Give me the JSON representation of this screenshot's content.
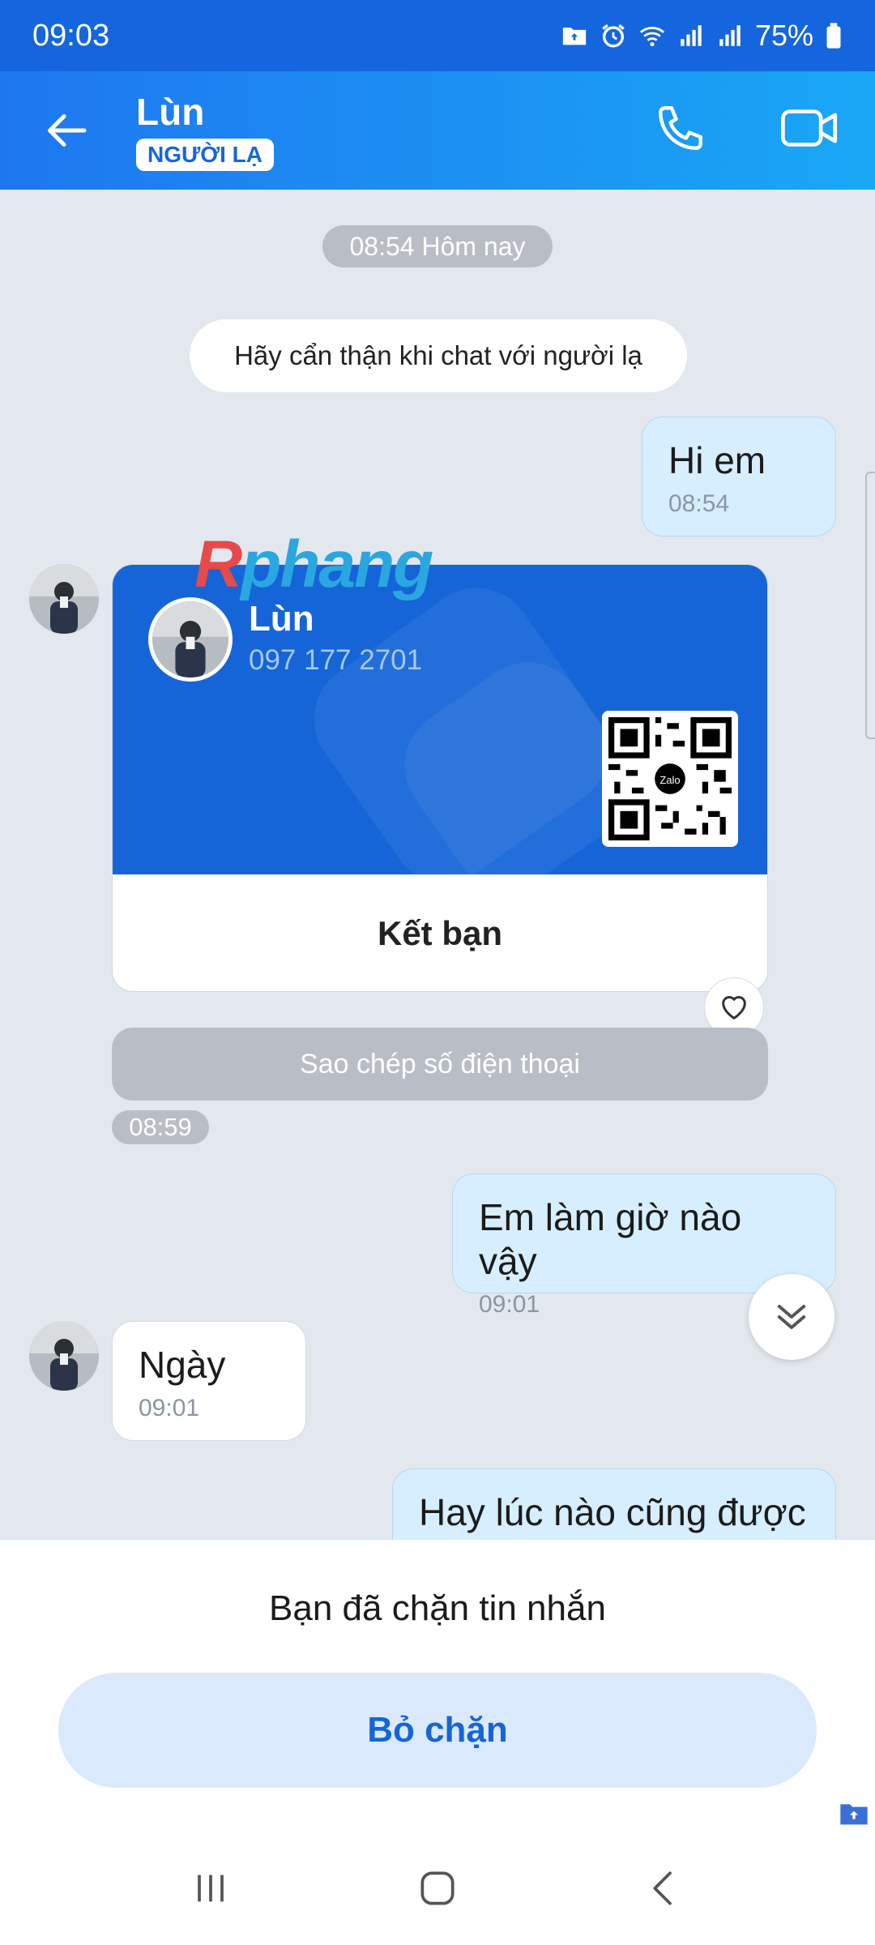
{
  "status_bar": {
    "time": "09:03",
    "battery": "75%",
    "icons": [
      "folder-upload-icon",
      "alarm-icon",
      "wifi-icon",
      "signal-icon",
      "signal-icon",
      "battery-icon"
    ]
  },
  "header": {
    "title": "Lùn",
    "badge": "NGƯỜI LẠ",
    "icons": {
      "back": "back-arrow-icon",
      "call": "phone-icon",
      "video": "video-call-icon"
    }
  },
  "chat": {
    "date_chip": "08:54 Hôm nay",
    "notice": "Hãy cẩn thận khi chat với người lạ",
    "messages": [
      {
        "direction": "out",
        "text": "Hi em",
        "time": "08:54"
      },
      {
        "direction": "out",
        "text": "Em làm giờ nào vậy",
        "time": "09:01"
      },
      {
        "direction": "in",
        "text": "Ngày",
        "time": "09:01"
      },
      {
        "direction": "out",
        "text": "Hay lúc nào cũng được",
        "time": ""
      }
    ],
    "contact_card": {
      "name": "Lùn",
      "phone": "097 177 2701",
      "qr_logo": "Zalo",
      "action": "Kết bạn",
      "copy_label": "Sao chép số điện thoại",
      "time": "08:59"
    },
    "watermark": {
      "first": "R",
      "rest": "phang"
    }
  },
  "blocked_panel": {
    "message": "Bạn đã chặn tin nhắn",
    "button": "Bỏ chặn"
  },
  "nav": {
    "icons": [
      "recent-apps-icon",
      "home-icon",
      "back-icon"
    ]
  },
  "colors": {
    "header_start": "#1e77f0",
    "header_end": "#19a7f5",
    "accent": "#1565d8",
    "chat_bg": "#e3e8ef",
    "out_bubble": "#d6eefe"
  }
}
